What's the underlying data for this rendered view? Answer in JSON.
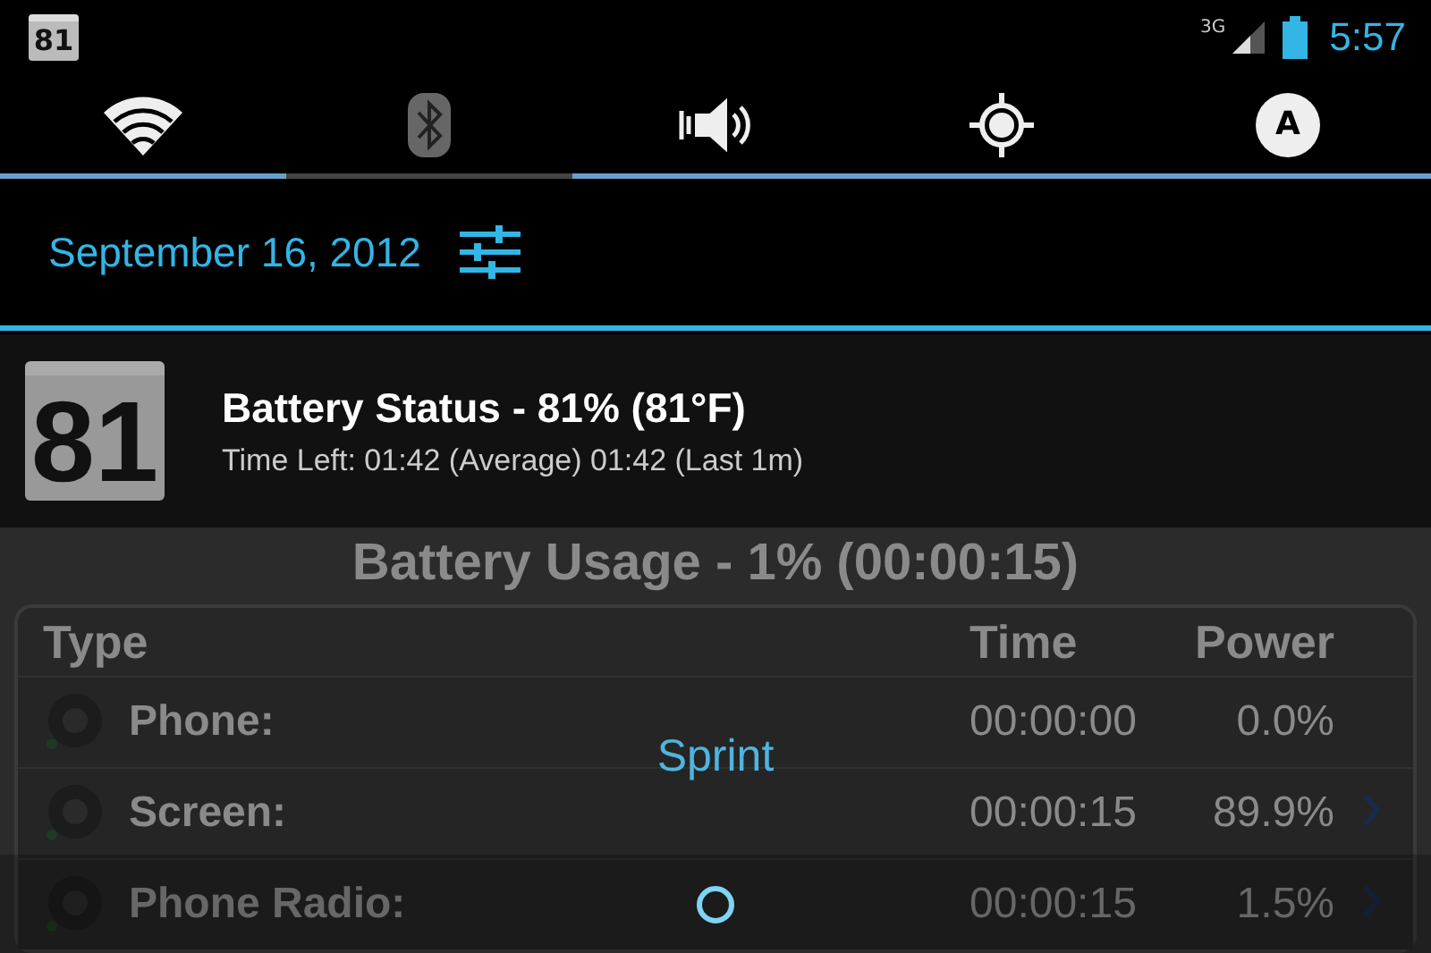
{
  "status_bar": {
    "app_badge": "81",
    "network": "3G",
    "time": "5:57"
  },
  "quick_toggles": [
    {
      "kind": "wifi",
      "on": true
    },
    {
      "kind": "bluetooth",
      "on": false
    },
    {
      "kind": "sound",
      "on": true
    },
    {
      "kind": "gps",
      "on": true
    },
    {
      "kind": "brightness",
      "on": true,
      "label": "A"
    }
  ],
  "date_row": {
    "date": "September 16, 2012"
  },
  "notification": {
    "badge": "81",
    "title": "Battery Status - 81% (81°F)",
    "text": "Time Left: 01:42 (Average) 01:42 (Last 1m)"
  },
  "app": {
    "title": "Battery Usage - 1% (00:00:15)",
    "columns": [
      "Type",
      "Time",
      "Power"
    ],
    "rows": [
      {
        "name": "Phone:",
        "time": "00:00:00",
        "power": "0.0%",
        "chevron": false
      },
      {
        "name": "Screen:",
        "time": "00:00:15",
        "power": "89.9%",
        "chevron": true
      },
      {
        "name": "Phone Radio:",
        "time": "00:00:15",
        "power": "1.5%",
        "chevron": true
      }
    ]
  },
  "toast": {
    "text": "Sprint"
  }
}
